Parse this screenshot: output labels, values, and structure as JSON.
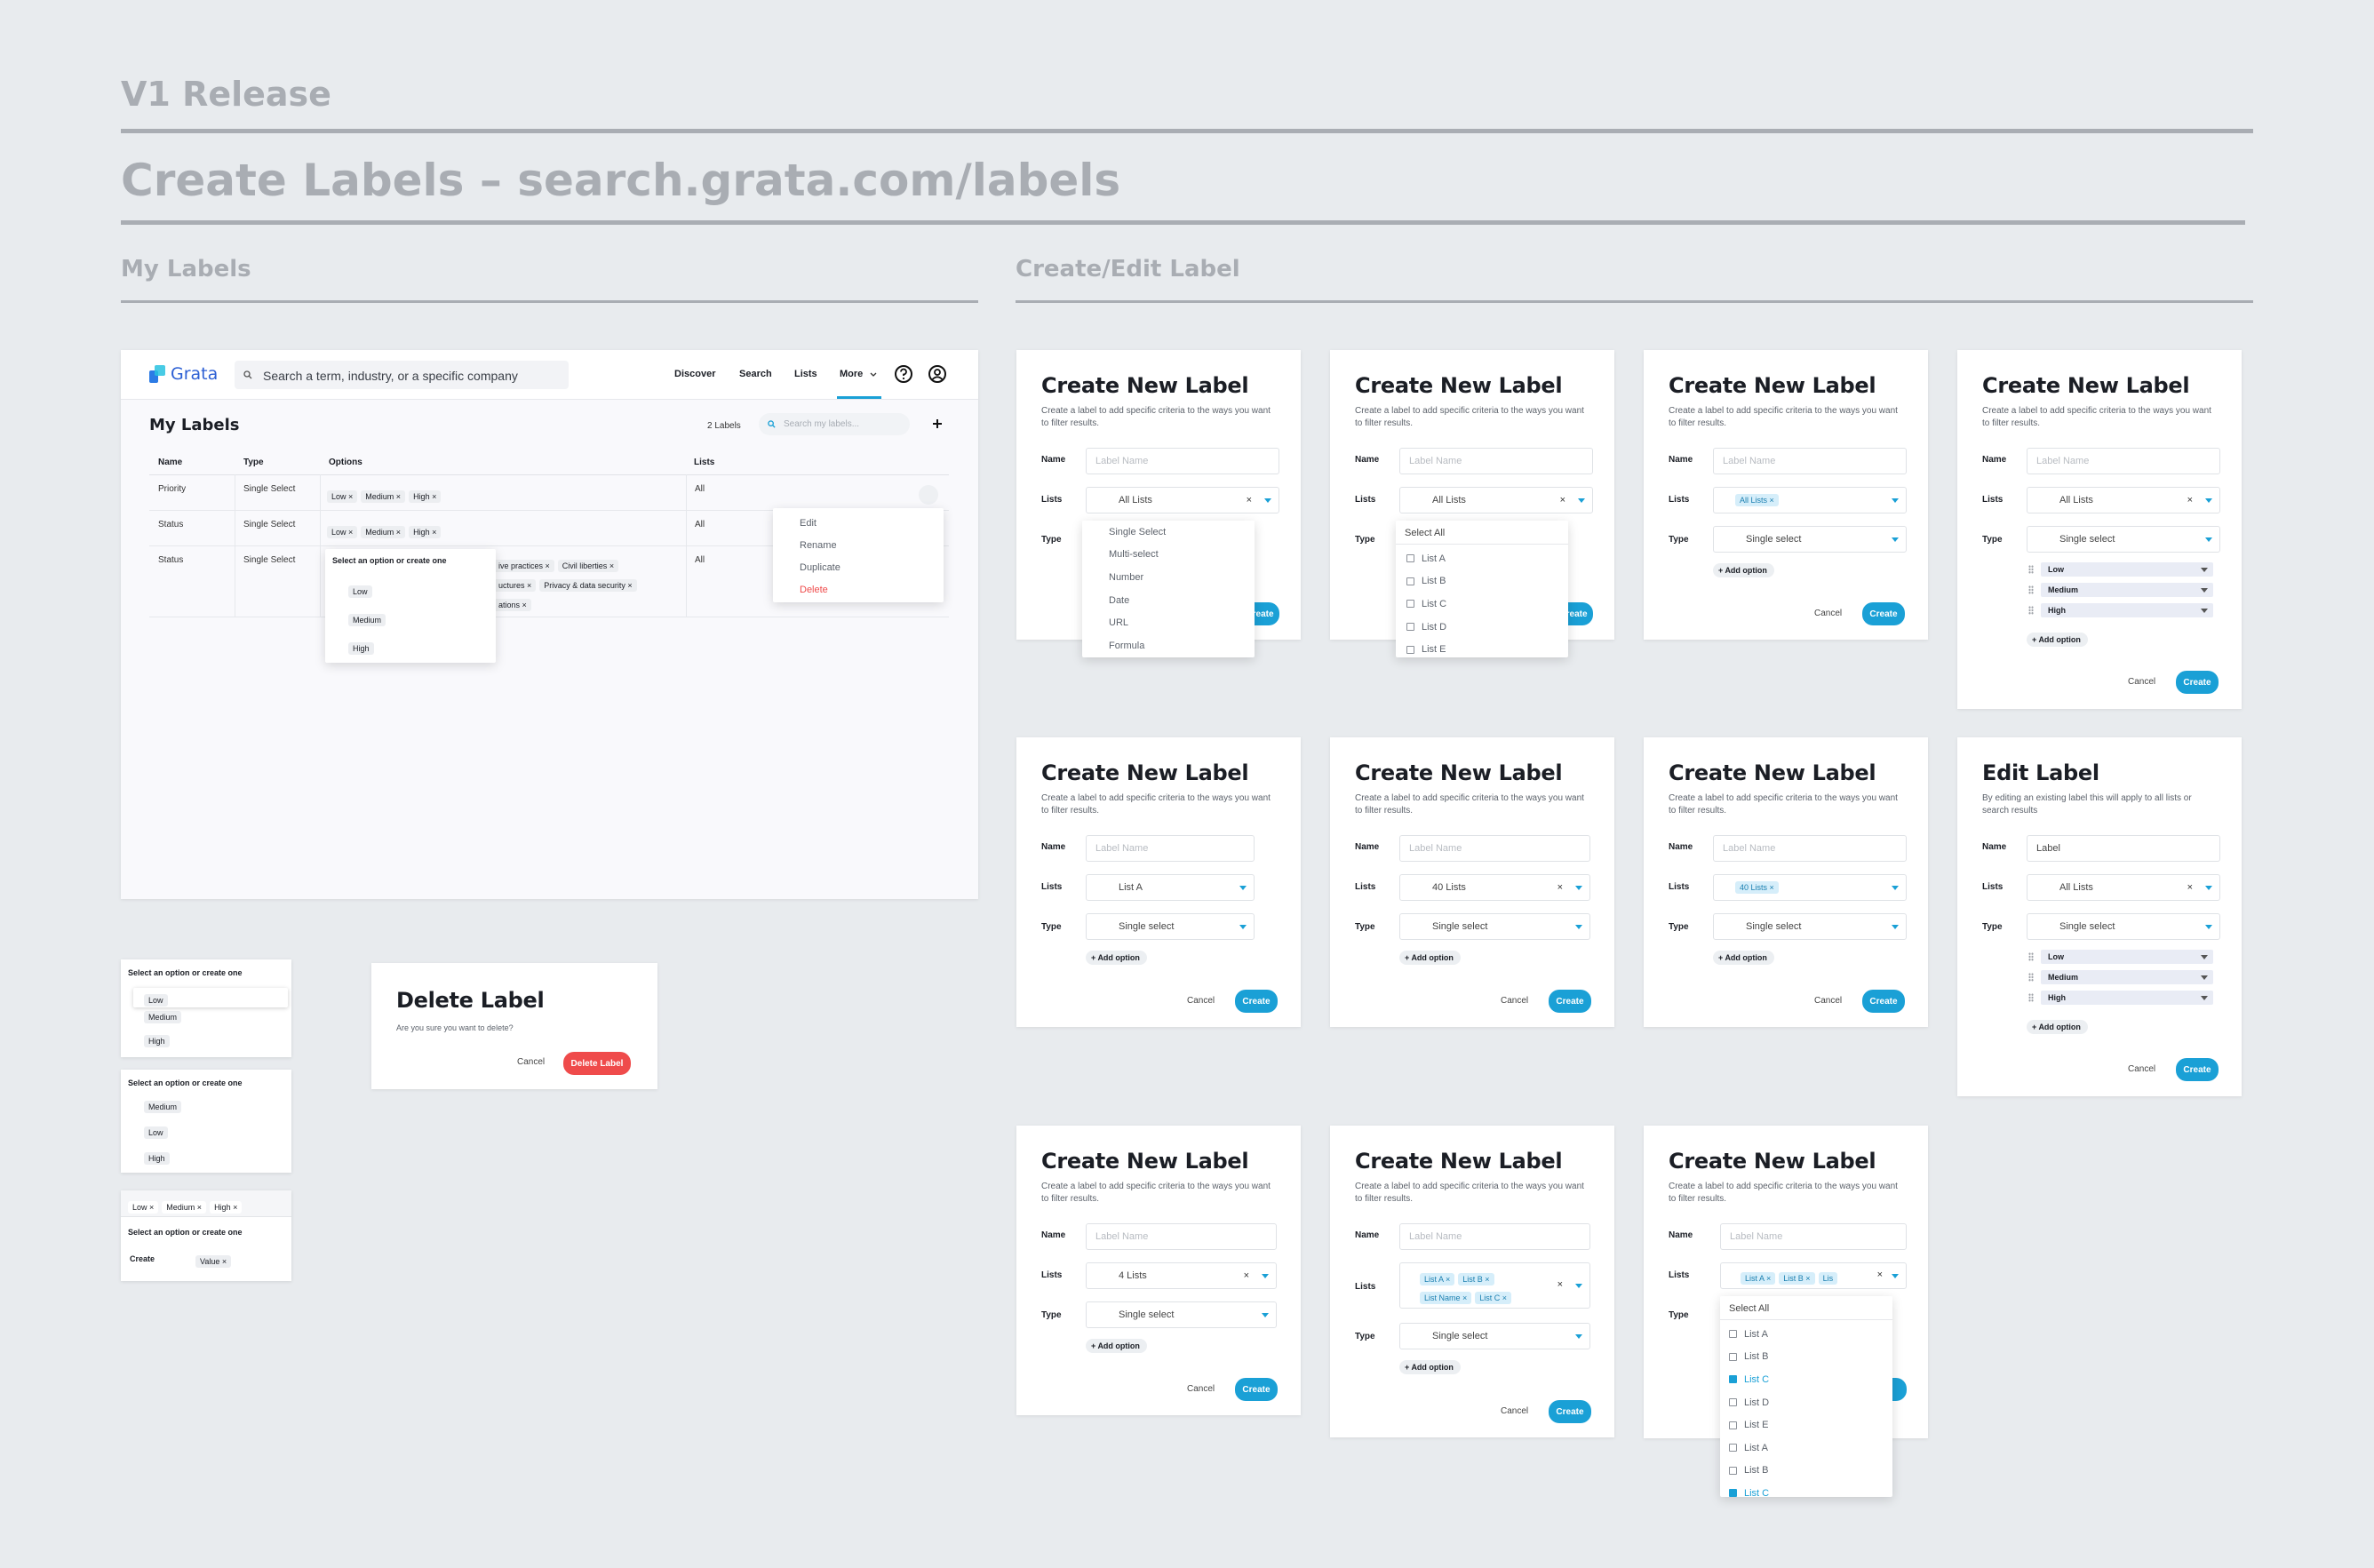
{
  "header": {
    "release": "V1 Release",
    "title": "Create Labels – search.grata.com/labels"
  },
  "sections": {
    "my_labels": "My Labels",
    "create_edit": "Create/Edit Label"
  },
  "app": {
    "logo": "Grata",
    "search_placeholder": "Search a term, industry, or a specific company",
    "nav": [
      "Discover",
      "Search",
      "Lists",
      "More"
    ],
    "icons": [
      "search-icon",
      "help-icon",
      "user-icon",
      "plus-icon",
      "chevron-down-icon",
      "close-icon",
      "checkbox-icon",
      "drag-handle-icon"
    ],
    "page_title": "My Labels",
    "count": "2 Labels",
    "filter_placeholder": "Search my labels...",
    "columns": [
      "Name",
      "Type",
      "Options",
      "Lists"
    ],
    "rows": [
      {
        "name": "Priority",
        "type": "Single Select",
        "options": [
          "Low",
          "Medium",
          "High"
        ],
        "lists": "All"
      },
      {
        "name": "Status",
        "type": "Single Select",
        "options": [
          "Low",
          "Medium",
          "High"
        ],
        "lists": "All"
      },
      {
        "name": "Status",
        "type": "Single Select",
        "options": [
          "ive practices",
          "Civil liberties",
          "uctures",
          "Privacy & data security",
          "ations"
        ],
        "lists": "All"
      }
    ],
    "row_menu": [
      "Edit",
      "Rename",
      "Duplicate",
      "Delete"
    ],
    "option_popover": {
      "title": "Select an option or create one",
      "options": [
        "Low",
        "Medium",
        "High"
      ]
    }
  },
  "mini": {
    "title": "Select an option or create one",
    "a": [
      "Low",
      "Medium",
      "High"
    ],
    "b": [
      "Medium",
      "Low",
      "High"
    ],
    "c_tags": [
      "Low",
      "Medium",
      "High"
    ],
    "c_create": "Create",
    "c_value": "Value"
  },
  "delete_dialog": {
    "title": "Delete Label",
    "text": "Are you sure you want to delete?",
    "cancel": "Cancel",
    "confirm": "Delete Label"
  },
  "form": {
    "title": "Create New Label",
    "edit_title": "Edit Label",
    "sub": "Create a label to add specific criteria to the ways you want to filter results.",
    "edit_sub": "By editing an existing label this will apply to all lists or search results",
    "name": "Name",
    "lists": "Lists",
    "type": "Type",
    "name_placeholder": "Label Name",
    "edit_name": "Label",
    "all_lists": "All Lists",
    "single": "Single select",
    "add_option": "Add option",
    "cancel": "Cancel",
    "create": "Create",
    "type_options": [
      "Single Select",
      "Multi-select",
      "Number",
      "Date",
      "URL",
      "Formula"
    ],
    "select_all": "Select All",
    "list_options": [
      "List A",
      "List B",
      "List C",
      "List D",
      "List E"
    ],
    "long_list": [
      "List A",
      "List B",
      "List C",
      "List D",
      "List E",
      "List A",
      "List B",
      "List C"
    ],
    "levels": [
      "Low",
      "Medium",
      "High"
    ],
    "list_a": "List A",
    "forty": "40 Lists",
    "four": "4 Lists",
    "chip_all": "All Lists",
    "chip_forty": "40 Lists",
    "chips_multi": [
      "List A",
      "List B",
      "List Name",
      "List C"
    ],
    "chips_row": [
      "List A",
      "List B",
      "Lis"
    ]
  },
  "colors": {
    "accent": "#1aa0d6",
    "danger": "#ef4b4b",
    "heading": "#a9adb3"
  }
}
